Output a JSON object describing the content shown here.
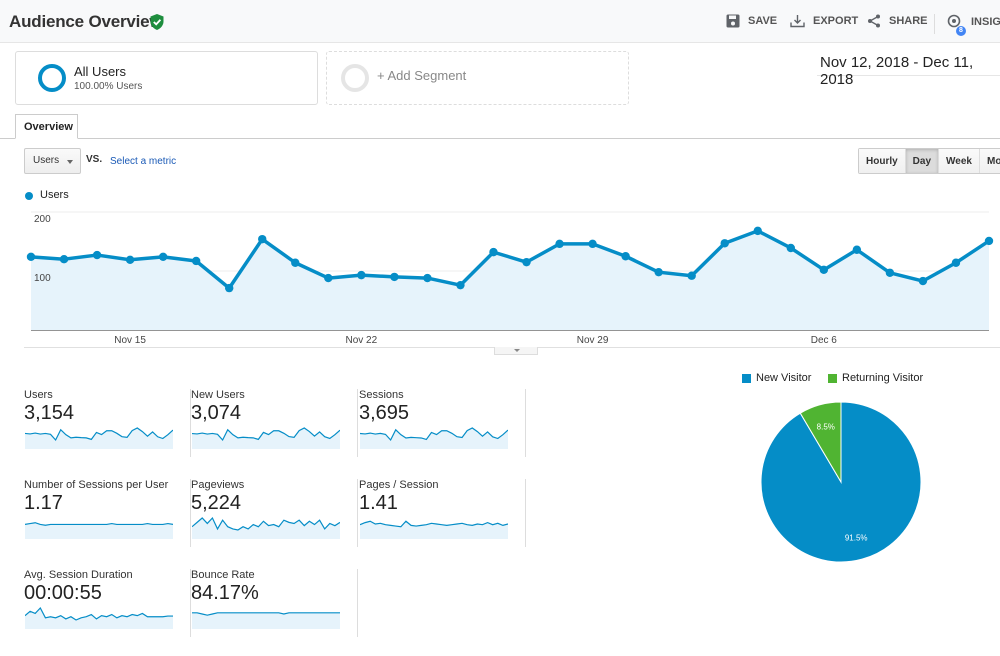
{
  "header": {
    "title": "Audience Overview",
    "verified_icon": "shield-check-icon",
    "actions": [
      {
        "label": "SAVE",
        "icon": "save-icon"
      },
      {
        "label": "EXPORT",
        "icon": "download-icon"
      },
      {
        "label": "SHARE",
        "icon": "share-icon"
      },
      {
        "label": "INSIGH",
        "icon": "insights-icon",
        "badge": "8"
      }
    ]
  },
  "segments": {
    "active": {
      "name": "All Users",
      "sub": "100.00% Users"
    },
    "add_label": "+ Add Segment"
  },
  "date_range": "Nov 12, 2018 - Dec 11, 2018",
  "tabs": [
    {
      "label": "Overview",
      "active": true
    }
  ],
  "controls": {
    "metric_selected": "Users",
    "vs_label": "VS.",
    "select_metric_link": "Select a metric",
    "granularity": [
      {
        "label": "Hourly",
        "active": false
      },
      {
        "label": "Day",
        "active": true
      },
      {
        "label": "Week",
        "active": false
      },
      {
        "label": "Month",
        "active": false
      }
    ]
  },
  "colors": {
    "primary": "#058dc7",
    "area_fill": "#e6f3fb",
    "returning": "#50b432"
  },
  "chart_data": [
    {
      "type": "area",
      "title": "Users",
      "legend": [
        "Users"
      ],
      "legend_position": "top-left",
      "x": [
        "Nov 12",
        "Nov 13",
        "Nov 14",
        "Nov 15",
        "Nov 16",
        "Nov 17",
        "Nov 18",
        "Nov 19",
        "Nov 20",
        "Nov 21",
        "Nov 22",
        "Nov 23",
        "Nov 24",
        "Nov 25",
        "Nov 26",
        "Nov 27",
        "Nov 28",
        "Nov 29",
        "Nov 30",
        "Dec 1",
        "Dec 2",
        "Dec 3",
        "Dec 4",
        "Dec 5",
        "Dec 6",
        "Dec 7",
        "Dec 8",
        "Dec 9",
        "Dec 10",
        "Dec 11"
      ],
      "series": [
        {
          "name": "Users",
          "values": [
            124,
            120,
            127,
            119,
            124,
            117,
            71,
            154,
            114,
            88,
            93,
            90,
            88,
            76,
            132,
            115,
            146,
            146,
            125,
            98,
            92,
            147,
            168,
            139,
            102,
            136,
            97,
            83,
            114,
            151
          ]
        }
      ],
      "x_ticks": [
        {
          "label": "Nov 15",
          "index": 3
        },
        {
          "label": "Nov 22",
          "index": 10
        },
        {
          "label": "Nov 29",
          "index": 17
        },
        {
          "label": "Dec 6",
          "index": 24
        }
      ],
      "y_ticks": [
        "100",
        "200"
      ],
      "ylim": [
        0,
        200
      ],
      "grid": true
    },
    {
      "type": "pie",
      "legend": [
        "New Visitor",
        "Returning Visitor"
      ],
      "legend_position": "top",
      "slices": [
        {
          "name": "New Visitor",
          "value": 91.5,
          "label": "91.5%",
          "color": "#058dc7"
        },
        {
          "name": "Returning Visitor",
          "value": 8.5,
          "label": "8.5%",
          "color": "#50b432"
        }
      ]
    }
  ],
  "metrics": [
    {
      "label": "Users",
      "value": "3,154",
      "spark": [
        124,
        120,
        127,
        119,
        124,
        117,
        71,
        154,
        114,
        88,
        93,
        90,
        88,
        76,
        132,
        115,
        146,
        146,
        125,
        98,
        92,
        147,
        168,
        139,
        102,
        136,
        97,
        83,
        114,
        151
      ]
    },
    {
      "label": "New Users",
      "value": "3,074",
      "spark": [
        120,
        117,
        124,
        116,
        121,
        114,
        69,
        150,
        111,
        86,
        91,
        88,
        86,
        74,
        129,
        112,
        142,
        142,
        122,
        96,
        90,
        143,
        164,
        136,
        100,
        133,
        95,
        81,
        111,
        147
      ]
    },
    {
      "label": "Sessions",
      "value": "3,695",
      "spark": [
        145,
        141,
        149,
        140,
        146,
        137,
        84,
        180,
        134,
        103,
        109,
        106,
        103,
        89,
        155,
        135,
        171,
        171,
        147,
        115,
        108,
        172,
        197,
        163,
        120,
        160,
        114,
        98,
        134,
        177
      ]
    },
    {
      "label": "Number of Sessions per User",
      "value": "1.17",
      "spark": [
        1.17,
        1.18,
        1.19,
        1.17,
        1.16,
        1.17,
        1.17,
        1.17,
        1.17,
        1.17,
        1.17,
        1.17,
        1.17,
        1.17,
        1.17,
        1.17,
        1.17,
        1.18,
        1.17,
        1.17,
        1.17,
        1.17,
        1.17,
        1.17,
        1.18,
        1.17,
        1.17,
        1.17,
        1.18,
        1.17
      ]
    },
    {
      "label": "Pageviews",
      "value": "5,224",
      "spark": [
        160,
        180,
        200,
        175,
        200,
        150,
        190,
        160,
        150,
        145,
        160,
        150,
        170,
        160,
        185,
        165,
        170,
        160,
        190,
        180,
        175,
        190,
        165,
        185,
        170,
        190,
        150,
        175,
        165,
        180
      ]
    },
    {
      "label": "Pages / Session",
      "value": "1.41",
      "spark": [
        1.4,
        1.43,
        1.45,
        1.41,
        1.42,
        1.4,
        1.39,
        1.38,
        1.37,
        1.45,
        1.39,
        1.38,
        1.39,
        1.4,
        1.42,
        1.41,
        1.4,
        1.39,
        1.4,
        1.41,
        1.42,
        1.4,
        1.39,
        1.41,
        1.4,
        1.43,
        1.4,
        1.42,
        1.39,
        1.41
      ]
    },
    {
      "label": "Avg. Session Duration",
      "value": "00:00:55",
      "spark": [
        50,
        70,
        60,
        85,
        40,
        45,
        40,
        50,
        35,
        45,
        30,
        40,
        45,
        55,
        35,
        50,
        45,
        55,
        40,
        50,
        45,
        55,
        50,
        60,
        45,
        45,
        45,
        45,
        48,
        48
      ]
    },
    {
      "label": "Bounce Rate",
      "value": "84.17%",
      "spark": [
        84,
        84,
        83,
        82,
        83,
        84,
        84,
        84,
        84,
        84,
        84,
        84,
        84,
        84,
        84,
        84,
        84,
        84,
        83,
        84,
        84,
        84,
        84,
        84,
        84,
        84,
        84,
        84,
        84,
        84
      ]
    }
  ]
}
